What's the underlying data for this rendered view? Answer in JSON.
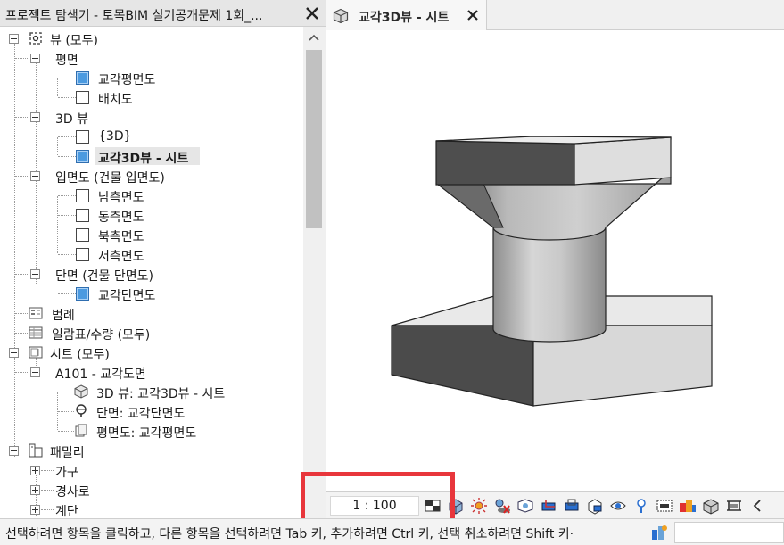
{
  "browser": {
    "title": "프로젝트 탐색기 - 토목BIM 실기공개문제 1회_...",
    "tree": {
      "views": "뷰 (모두)",
      "floor_plans": "평면",
      "fp_bridge": "교각평면도",
      "fp_site": "배치도",
      "views_3d": "3D 뷰",
      "v3d_default": "{3D}",
      "v3d_sheet": "교각3D뷰 - 시트",
      "elevations": "입면도 (건물 입면도)",
      "el_south": "남측면도",
      "el_east": "동측면도",
      "el_north": "북측면도",
      "el_west": "서측면도",
      "sections": "단면 (건물 단면도)",
      "sec_bridge": "교각단면도",
      "legends": "범례",
      "schedules": "일람표/수량 (모두)",
      "sheets": "시트 (모두)",
      "sheet_a101": "A101 - 교각도면",
      "sheet_3d": "3D 뷰: 교각3D뷰 - 시트",
      "sheet_sec": "단면: 교각단면도",
      "sheet_plan": "평면도: 교각평면도",
      "families": "패밀리",
      "fam_furniture": "가구",
      "fam_ramp": "경사로",
      "fam_stairs": "계단"
    }
  },
  "tab": {
    "label": "교각3D뷰 - 시트"
  },
  "view_control": {
    "scale": "1 : 100"
  },
  "status": {
    "text": "선택하려면 항목을 클릭하고, 다른 항목을 선택하려면 Tab 키, 추가하려면 Ctrl 키, 선택 취소하려면 Shift 키·"
  },
  "colors": {
    "accent_blue": "#4b9ae0",
    "highlight_red": "#e8363c"
  }
}
